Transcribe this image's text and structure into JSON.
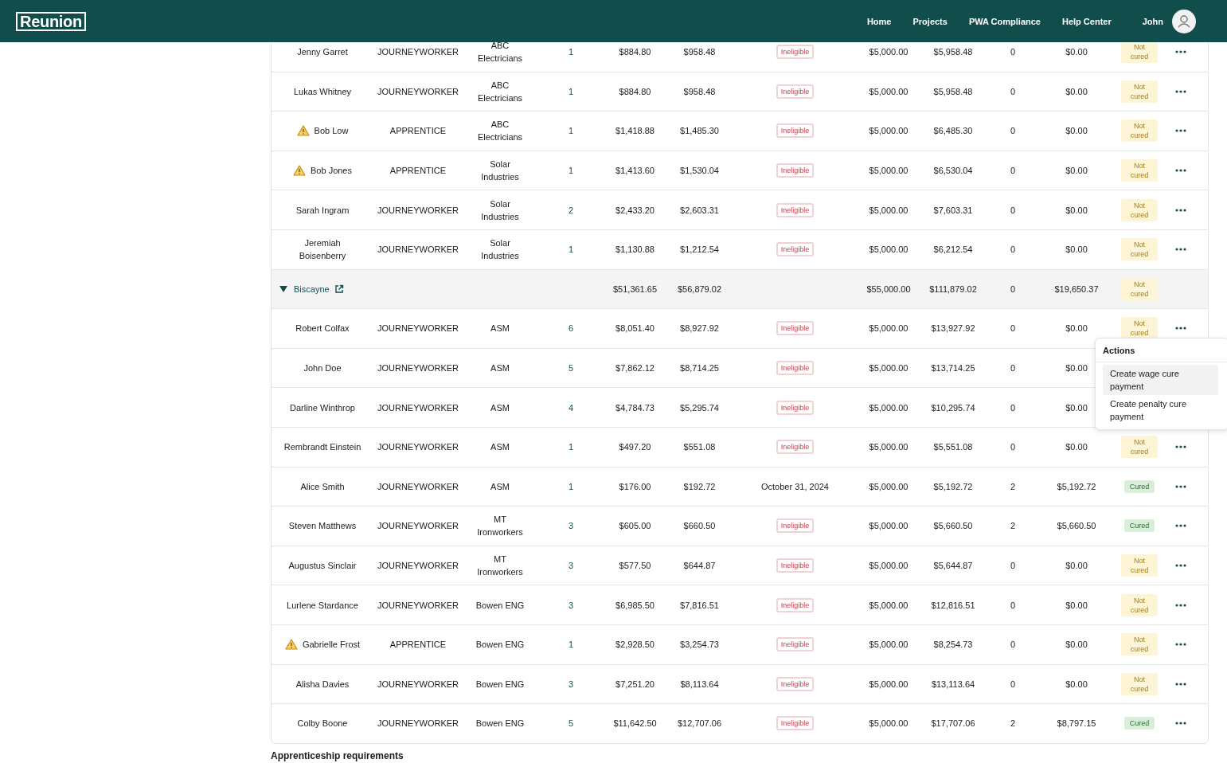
{
  "header": {
    "logo": "Reunion",
    "nav": [
      {
        "label": "Home"
      },
      {
        "label": "Projects"
      },
      {
        "label": "PWA Compliance"
      },
      {
        "label": "Help Center"
      }
    ],
    "user": "John"
  },
  "rows": [
    {
      "kind": "worker",
      "name": "Jenny Garret",
      "warning": false,
      "classification": "JOURNEYWORKER",
      "company": "ABC Electricians",
      "count": "1",
      "amount_1": "$884.80",
      "amount_2": "$958.48",
      "status": {
        "kind": "badge",
        "text": "Ineligible"
      },
      "amount_3": "$5,000.00",
      "amount_4": "$5,958.48",
      "count_2": "0",
      "amount_5": "$0.00",
      "cure": {
        "text": "Not cured",
        "cured": false
      }
    },
    {
      "kind": "worker",
      "name": "Lukas Whitney",
      "warning": false,
      "classification": "JOURNEYWORKER",
      "company": "ABC Electricians",
      "count": "1",
      "amount_1": "$884.80",
      "amount_2": "$958.48",
      "status": {
        "kind": "badge",
        "text": "Ineligible"
      },
      "amount_3": "$5,000.00",
      "amount_4": "$5,958.48",
      "count_2": "0",
      "amount_5": "$0.00",
      "cure": {
        "text": "Not cured",
        "cured": false
      }
    },
    {
      "kind": "worker",
      "name": "Bob Low",
      "warning": true,
      "classification": "APPRENTICE",
      "company": "ABC Electricians",
      "count": "1",
      "amount_1": "$1,418.88",
      "amount_2": "$1,485.30",
      "status": {
        "kind": "badge",
        "text": "Ineligible"
      },
      "amount_3": "$5,000.00",
      "amount_4": "$6,485.30",
      "count_2": "0",
      "amount_5": "$0.00",
      "cure": {
        "text": "Not cured",
        "cured": false
      }
    },
    {
      "kind": "worker",
      "name": "Bob Jones",
      "warning": true,
      "classification": "APPRENTICE",
      "company": "Solar Industries",
      "count": "1",
      "amount_1": "$1,413.60",
      "amount_2": "$1,530.04",
      "status": {
        "kind": "badge",
        "text": "Ineligible"
      },
      "amount_3": "$5,000.00",
      "amount_4": "$6,530.04",
      "count_2": "0",
      "amount_5": "$0.00",
      "cure": {
        "text": "Not cured",
        "cured": false
      }
    },
    {
      "kind": "worker",
      "name": "Sarah Ingram",
      "warning": false,
      "classification": "JOURNEYWORKER",
      "company": "Solar Industries",
      "count": "2",
      "amount_1": "$2,433.20",
      "amount_2": "$2,603.31",
      "status": {
        "kind": "badge",
        "text": "Ineligible"
      },
      "amount_3": "$5,000.00",
      "amount_4": "$7,603.31",
      "count_2": "0",
      "amount_5": "$0.00",
      "cure": {
        "text": "Not cured",
        "cured": false
      }
    },
    {
      "kind": "worker",
      "name": "Jeremiah Boisenberry",
      "warning": false,
      "classification": "JOURNEYWORKER",
      "company": "Solar Industries",
      "count": "1",
      "amount_1": "$1,130.88",
      "amount_2": "$1,212.54",
      "status": {
        "kind": "badge",
        "text": "Ineligible"
      },
      "amount_3": "$5,000.00",
      "amount_4": "$6,212.54",
      "count_2": "0",
      "amount_5": "$0.00",
      "cure": {
        "text": "Not cured",
        "cured": false
      }
    },
    {
      "kind": "group",
      "name": "Biscayne",
      "expanded": true,
      "amount_1": "$51,361.65",
      "amount_2": "$56,879.02",
      "amount_3": "$55,000.00",
      "amount_4": "$111,879.02",
      "count_2": "0",
      "amount_5": "$19,650.37",
      "cure": {
        "text": "Not cured",
        "cured": false
      }
    },
    {
      "kind": "worker",
      "name": "Robert Colfax",
      "warning": false,
      "classification": "JOURNEYWORKER",
      "company": "ASM",
      "count": "6",
      "amount_1": "$8,051.40",
      "amount_2": "$8,927.92",
      "status": {
        "kind": "badge",
        "text": "Ineligible"
      },
      "amount_3": "$5,000.00",
      "amount_4": "$13,927.92",
      "count_2": "0",
      "amount_5": "$0.00",
      "cure": {
        "text": "Not cured",
        "cured": false
      },
      "actions_menu": {
        "title": "Actions",
        "items": [
          {
            "label": "Create wage cure payment",
            "selected": true
          },
          {
            "label": "Create penalty cure payment",
            "selected": false
          }
        ]
      }
    },
    {
      "kind": "worker",
      "name": "John Doe",
      "warning": false,
      "classification": "JOURNEYWORKER",
      "company": "ASM",
      "count": "5",
      "amount_1": "$7,862.12",
      "amount_2": "$8,714.25",
      "status": {
        "kind": "badge",
        "text": "Ineligible"
      },
      "amount_3": "$5,000.00",
      "amount_4": "$13,714.25",
      "count_2": "0",
      "amount_5": "$0.00"
    },
    {
      "kind": "worker",
      "name": "Darline Winthrop",
      "warning": false,
      "classification": "JOURNEYWORKER",
      "company": "ASM",
      "count": "4",
      "amount_1": "$4,784.73",
      "amount_2": "$5,295.74",
      "status": {
        "kind": "badge",
        "text": "Ineligible"
      },
      "amount_3": "$5,000.00",
      "amount_4": "$10,295.74",
      "count_2": "0",
      "amount_5": "$0.00"
    },
    {
      "kind": "worker",
      "name": "Rembrandt Einstein",
      "warning": false,
      "classification": "JOURNEYWORKER",
      "company": "ASM",
      "count": "1",
      "amount_1": "$497.20",
      "amount_2": "$551.08",
      "status": {
        "kind": "badge",
        "text": "Ineligible"
      },
      "amount_3": "$5,000.00",
      "amount_4": "$5,551.08",
      "count_2": "0",
      "amount_5": "$0.00",
      "cure": {
        "text": "Not cured",
        "cured": false
      }
    },
    {
      "kind": "worker",
      "name": "Alice Smith",
      "warning": false,
      "classification": "JOURNEYWORKER",
      "company": "ASM",
      "count": "1",
      "amount_1": "$176.00",
      "amount_2": "$192.72",
      "status": {
        "kind": "date",
        "text": "October 31, 2024"
      },
      "amount_3": "$5,000.00",
      "amount_4": "$5,192.72",
      "count_2": "2",
      "amount_5": "$5,192.72",
      "cure": {
        "text": "Cured",
        "cured": true
      }
    },
    {
      "kind": "worker",
      "name": "Steven Matthews",
      "warning": false,
      "classification": "JOURNEYWORKER",
      "company": "MT Ironworkers",
      "count": "3",
      "amount_1": "$605.00",
      "amount_2": "$660.50",
      "status": {
        "kind": "badge",
        "text": "Ineligible"
      },
      "amount_3": "$5,000.00",
      "amount_4": "$5,660.50",
      "count_2": "2",
      "amount_5": "$5,660.50",
      "cure": {
        "text": "Cured",
        "cured": true
      }
    },
    {
      "kind": "worker",
      "name": "Augustus Sinclair",
      "warning": false,
      "classification": "JOURNEYWORKER",
      "company": "MT Ironworkers",
      "count": "3",
      "amount_1": "$577.50",
      "amount_2": "$644.87",
      "status": {
        "kind": "badge",
        "text": "Ineligible"
      },
      "amount_3": "$5,000.00",
      "amount_4": "$5,644.87",
      "count_2": "0",
      "amount_5": "$0.00",
      "cure": {
        "text": "Not cured",
        "cured": false
      }
    },
    {
      "kind": "worker",
      "name": "Lurlene Stardance",
      "warning": false,
      "classification": "JOURNEYWORKER",
      "company": "Bowen ENG",
      "count": "3",
      "amount_1": "$6,985.50",
      "amount_2": "$7,816.51",
      "status": {
        "kind": "badge",
        "text": "Ineligible"
      },
      "amount_3": "$5,000.00",
      "amount_4": "$12,816.51",
      "count_2": "0",
      "amount_5": "$0.00",
      "cure": {
        "text": "Not cured",
        "cured": false
      }
    },
    {
      "kind": "worker",
      "name": "Gabrielle Frost",
      "warning": true,
      "classification": "APPRENTICE",
      "company": "Bowen ENG",
      "count": "1",
      "amount_1": "$2,928.50",
      "amount_2": "$3,254.73",
      "status": {
        "kind": "badge",
        "text": "Ineligible"
      },
      "amount_3": "$5,000.00",
      "amount_4": "$8,254.73",
      "count_2": "0",
      "amount_5": "$0.00",
      "cure": {
        "text": "Not cured",
        "cured": false
      }
    },
    {
      "kind": "worker",
      "name": "Alisha Davies",
      "warning": false,
      "classification": "JOURNEYWORKER",
      "company": "Bowen ENG",
      "count": "3",
      "amount_1": "$7,251.20",
      "amount_2": "$8,113.64",
      "status": {
        "kind": "badge",
        "text": "Ineligible"
      },
      "amount_3": "$5,000.00",
      "amount_4": "$13,113.64",
      "count_2": "0",
      "amount_5": "$0.00",
      "cure": {
        "text": "Not cured",
        "cured": false
      }
    },
    {
      "kind": "worker",
      "name": "Colby Boone",
      "warning": false,
      "classification": "JOURNEYWORKER",
      "company": "Bowen ENG",
      "count": "5",
      "amount_1": "$11,642.50",
      "amount_2": "$12,707.06",
      "status": {
        "kind": "badge",
        "text": "Ineligible"
      },
      "amount_3": "$5,000.00",
      "amount_4": "$17,707.06",
      "count_2": "2",
      "amount_5": "$8,797.15",
      "cure": {
        "text": "Cured",
        "cured": true
      }
    }
  ],
  "next_section": {
    "title": "Apprenticeship requirements"
  }
}
